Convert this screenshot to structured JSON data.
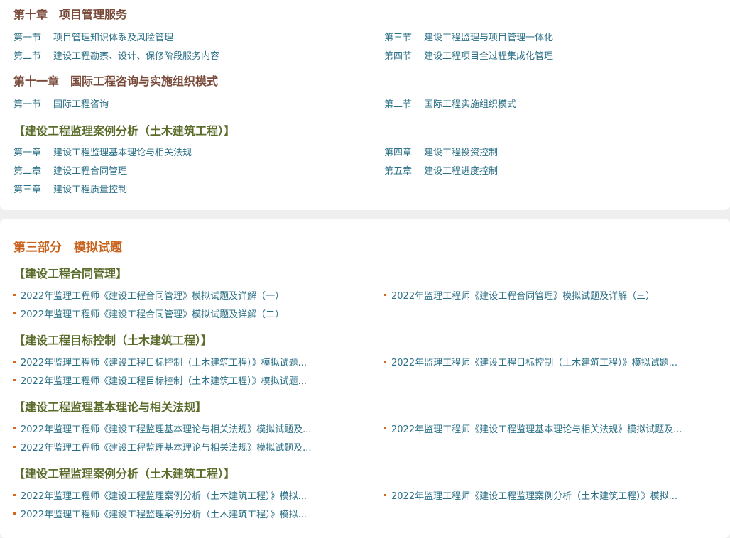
{
  "section1": {
    "ch10": {
      "title": "第十章　项目管理服务",
      "items": [
        {
          "num": "第一节",
          "label": "项目管理知识体系及风险管理"
        },
        {
          "num": "第三节",
          "label": "建设工程监理与项目管理一体化"
        },
        {
          "num": "第二节",
          "label": "建设工程勘察、设计、保修阶段服务内容"
        },
        {
          "num": "第四节",
          "label": "建设工程项目全过程集成化管理"
        }
      ]
    },
    "ch11": {
      "title": "第十一章　国际工程咨询与实施组织模式",
      "items": [
        {
          "num": "第一节",
          "label": "国际工程咨询"
        },
        {
          "num": "第二节",
          "label": "国际工程实施组织模式"
        }
      ]
    },
    "case": {
      "title": "【建设工程监理案例分析（土木建筑工程）】",
      "items": [
        {
          "num": "第一章",
          "label": "建设工程监理基本理论与相关法规"
        },
        {
          "num": "第四章",
          "label": "建设工程投资控制"
        },
        {
          "num": "第二章",
          "label": "建设工程合同管理"
        },
        {
          "num": "第五章",
          "label": "建设工程进度控制"
        },
        {
          "num": "第三章",
          "label": "建设工程质量控制"
        }
      ]
    }
  },
  "part3": {
    "title": "第三部分　模拟试题",
    "groups": [
      {
        "title": "【建设工程合同管理】",
        "links": [
          "2022年监理工程师《建设工程合同管理》模拟试题及详解（一）",
          "2022年监理工程师《建设工程合同管理》模拟试题及详解（三）",
          "2022年监理工程师《建设工程合同管理》模拟试题及详解（二）"
        ]
      },
      {
        "title": "【建设工程目标控制（土木建筑工程）】",
        "links": [
          "2022年监理工程师《建设工程目标控制（土木建筑工程）》模拟试题...",
          "2022年监理工程师《建设工程目标控制（土木建筑工程）》模拟试题...",
          "2022年监理工程师《建设工程目标控制（土木建筑工程）》模拟试题..."
        ]
      },
      {
        "title": "【建设工程监理基本理论与相关法规】",
        "links": [
          "2022年监理工程师《建设工程监理基本理论与相关法规》模拟试题及...",
          "2022年监理工程师《建设工程监理基本理论与相关法规》模拟试题及...",
          "2022年监理工程师《建设工程监理基本理论与相关法规》模拟试题及..."
        ]
      },
      {
        "title": "【建设工程监理案例分析（土木建筑工程）】",
        "links": [
          "2022年监理工程师《建设工程监理案例分析（土木建筑工程）》模拟...",
          "2022年监理工程师《建设工程监理案例分析（土木建筑工程）》模拟...",
          "2022年监理工程师《建设工程监理案例分析（土木建筑工程）》模拟..."
        ]
      }
    ]
  },
  "colors": {
    "chapter": "#7a4b3a",
    "part": "#c8621c",
    "category": "#5a6b2a",
    "link": "#2a6f86",
    "bullet": "#d2691e"
  }
}
